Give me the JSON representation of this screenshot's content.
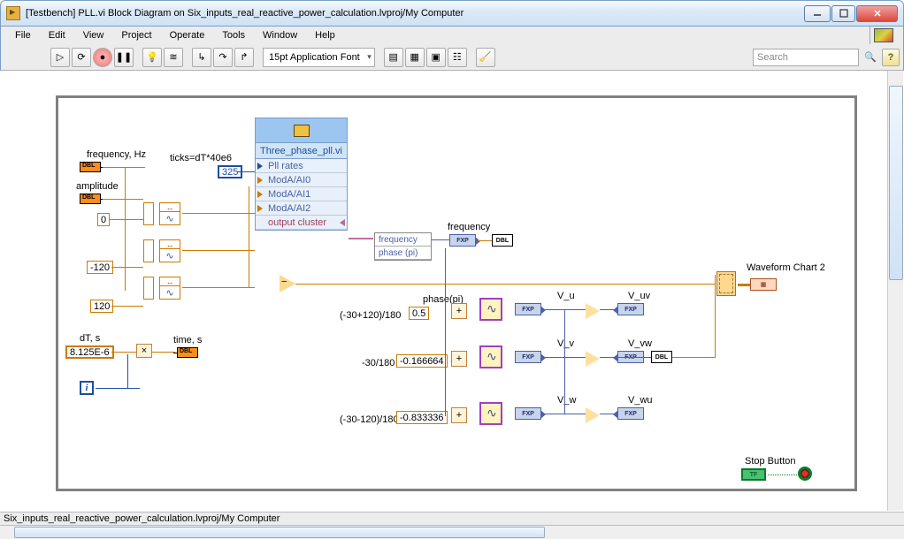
{
  "window": {
    "title": "[Testbench] PLL.vi Block Diagram on Six_inputs_real_reactive_power_calculation.lvproj/My Computer"
  },
  "menu": {
    "file": "File",
    "edit": "Edit",
    "view": "View",
    "project": "Project",
    "operate": "Operate",
    "tools": "Tools",
    "window": "Window",
    "help": "Help"
  },
  "toolbar": {
    "font": "15pt Application Font",
    "search_placeholder": "Search",
    "help": "?"
  },
  "status": {
    "path": "Six_inputs_real_reactive_power_calculation.lvproj/My Computer"
  },
  "labels": {
    "frequency_hz": "frequency, Hz",
    "amplitude": "amplitude",
    "ticks": "ticks=dT*40e6",
    "ticks_val": "325",
    "zero": "0",
    "neg120": "-120",
    "pos120": "120",
    "dT": "dT, s",
    "dT_val": "8.125E-6",
    "time": "time, s",
    "subvi_title": "Three_phase_pll.vi",
    "subvi_rows": {
      "r0": "Pll rates",
      "r1": "ModA/AI0",
      "r2": "ModA/AI1",
      "r3": "ModA/AI2",
      "r4": "output cluster"
    },
    "unbundle": {
      "frequency": "frequency",
      "phase": "phase (pi)"
    },
    "frequency_out": "frequency",
    "phase_pi": "phase(pi)",
    "p_half": "0.5",
    "p_half_expr": "(-30+120)/180",
    "p_neg": "-0.166664",
    "p_neg_expr": "-30/180",
    "p_neg2": "-0.833336",
    "p_neg2_expr": "(-30-120)/180",
    "vu": "V_u",
    "vv": "V_v",
    "vw": "V_w",
    "vuv": "V_uv",
    "vvw": "V_vw",
    "vwu": "V_wu",
    "wfchart": "Waveform Chart 2",
    "stop": "Stop Button",
    "tf": "TF",
    "i": "i"
  }
}
